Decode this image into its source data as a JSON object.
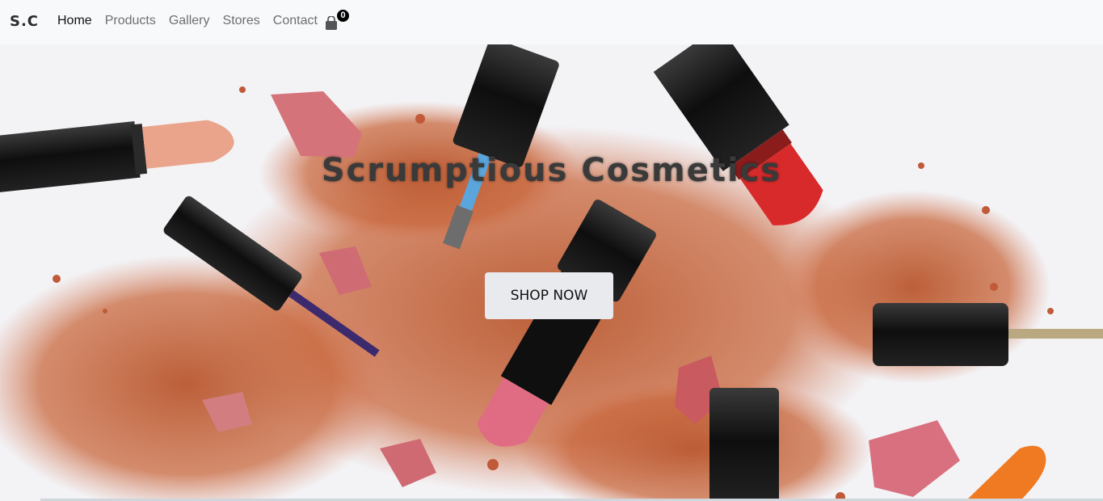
{
  "navbar": {
    "brand": "S.C",
    "links": [
      {
        "label": "Home",
        "active": true
      },
      {
        "label": "Products",
        "active": false
      },
      {
        "label": "Gallery",
        "active": false
      },
      {
        "label": "Stores",
        "active": false
      },
      {
        "label": "Contact",
        "active": false
      }
    ],
    "cart": {
      "icon": "shopping-bag-icon",
      "count": "0"
    }
  },
  "hero": {
    "title": "Scrumptious Cosmetics",
    "button_label": "SHOP NOW",
    "image": "cosmetics-background-image"
  },
  "colors": {
    "navbar_bg": "#f8f9fa",
    "powder": "#c8603a",
    "lipstick_black": "#141414",
    "button_bg": "#e9eaee"
  }
}
